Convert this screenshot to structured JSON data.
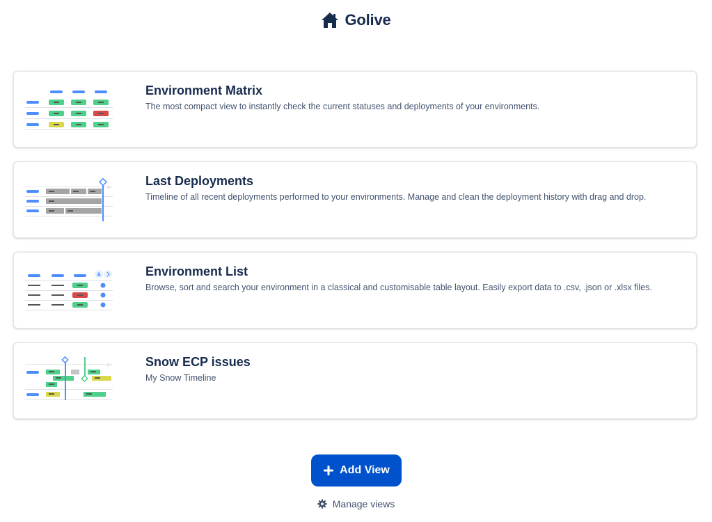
{
  "header": {
    "title": "Golive",
    "icon": "home-icon"
  },
  "views": [
    {
      "name": "Environment Matrix",
      "description": "The most compact view to instantly check the current statuses and deployments of your environments.",
      "icon": "matrix-thumbnail"
    },
    {
      "name": "Last Deployments",
      "description": "Timeline of all recent deployments performed to your environments. Manage and clean the deployment history with drag and drop.",
      "icon": "timeline-thumbnail"
    },
    {
      "name": "Environment List",
      "description": "Browse, sort and search your environment in a classical and customisable table layout. Easily export data to .csv, .json or .xlsx files.",
      "icon": "list-thumbnail"
    },
    {
      "name": "Snow ECP issues",
      "description": "My Snow Timeline",
      "icon": "issues-timeline-thumbnail"
    }
  ],
  "actions": {
    "add_view_label": "Add View",
    "manage_views_label": "Manage views"
  },
  "colors": {
    "primary": "#0052cc",
    "text": "#172b4d",
    "subtle": "#42526e",
    "green": "#4fd08a",
    "red": "#d94848",
    "yellow": "#d9d84a",
    "gray": "#a5a5a5",
    "blue": "#4c8dff"
  }
}
